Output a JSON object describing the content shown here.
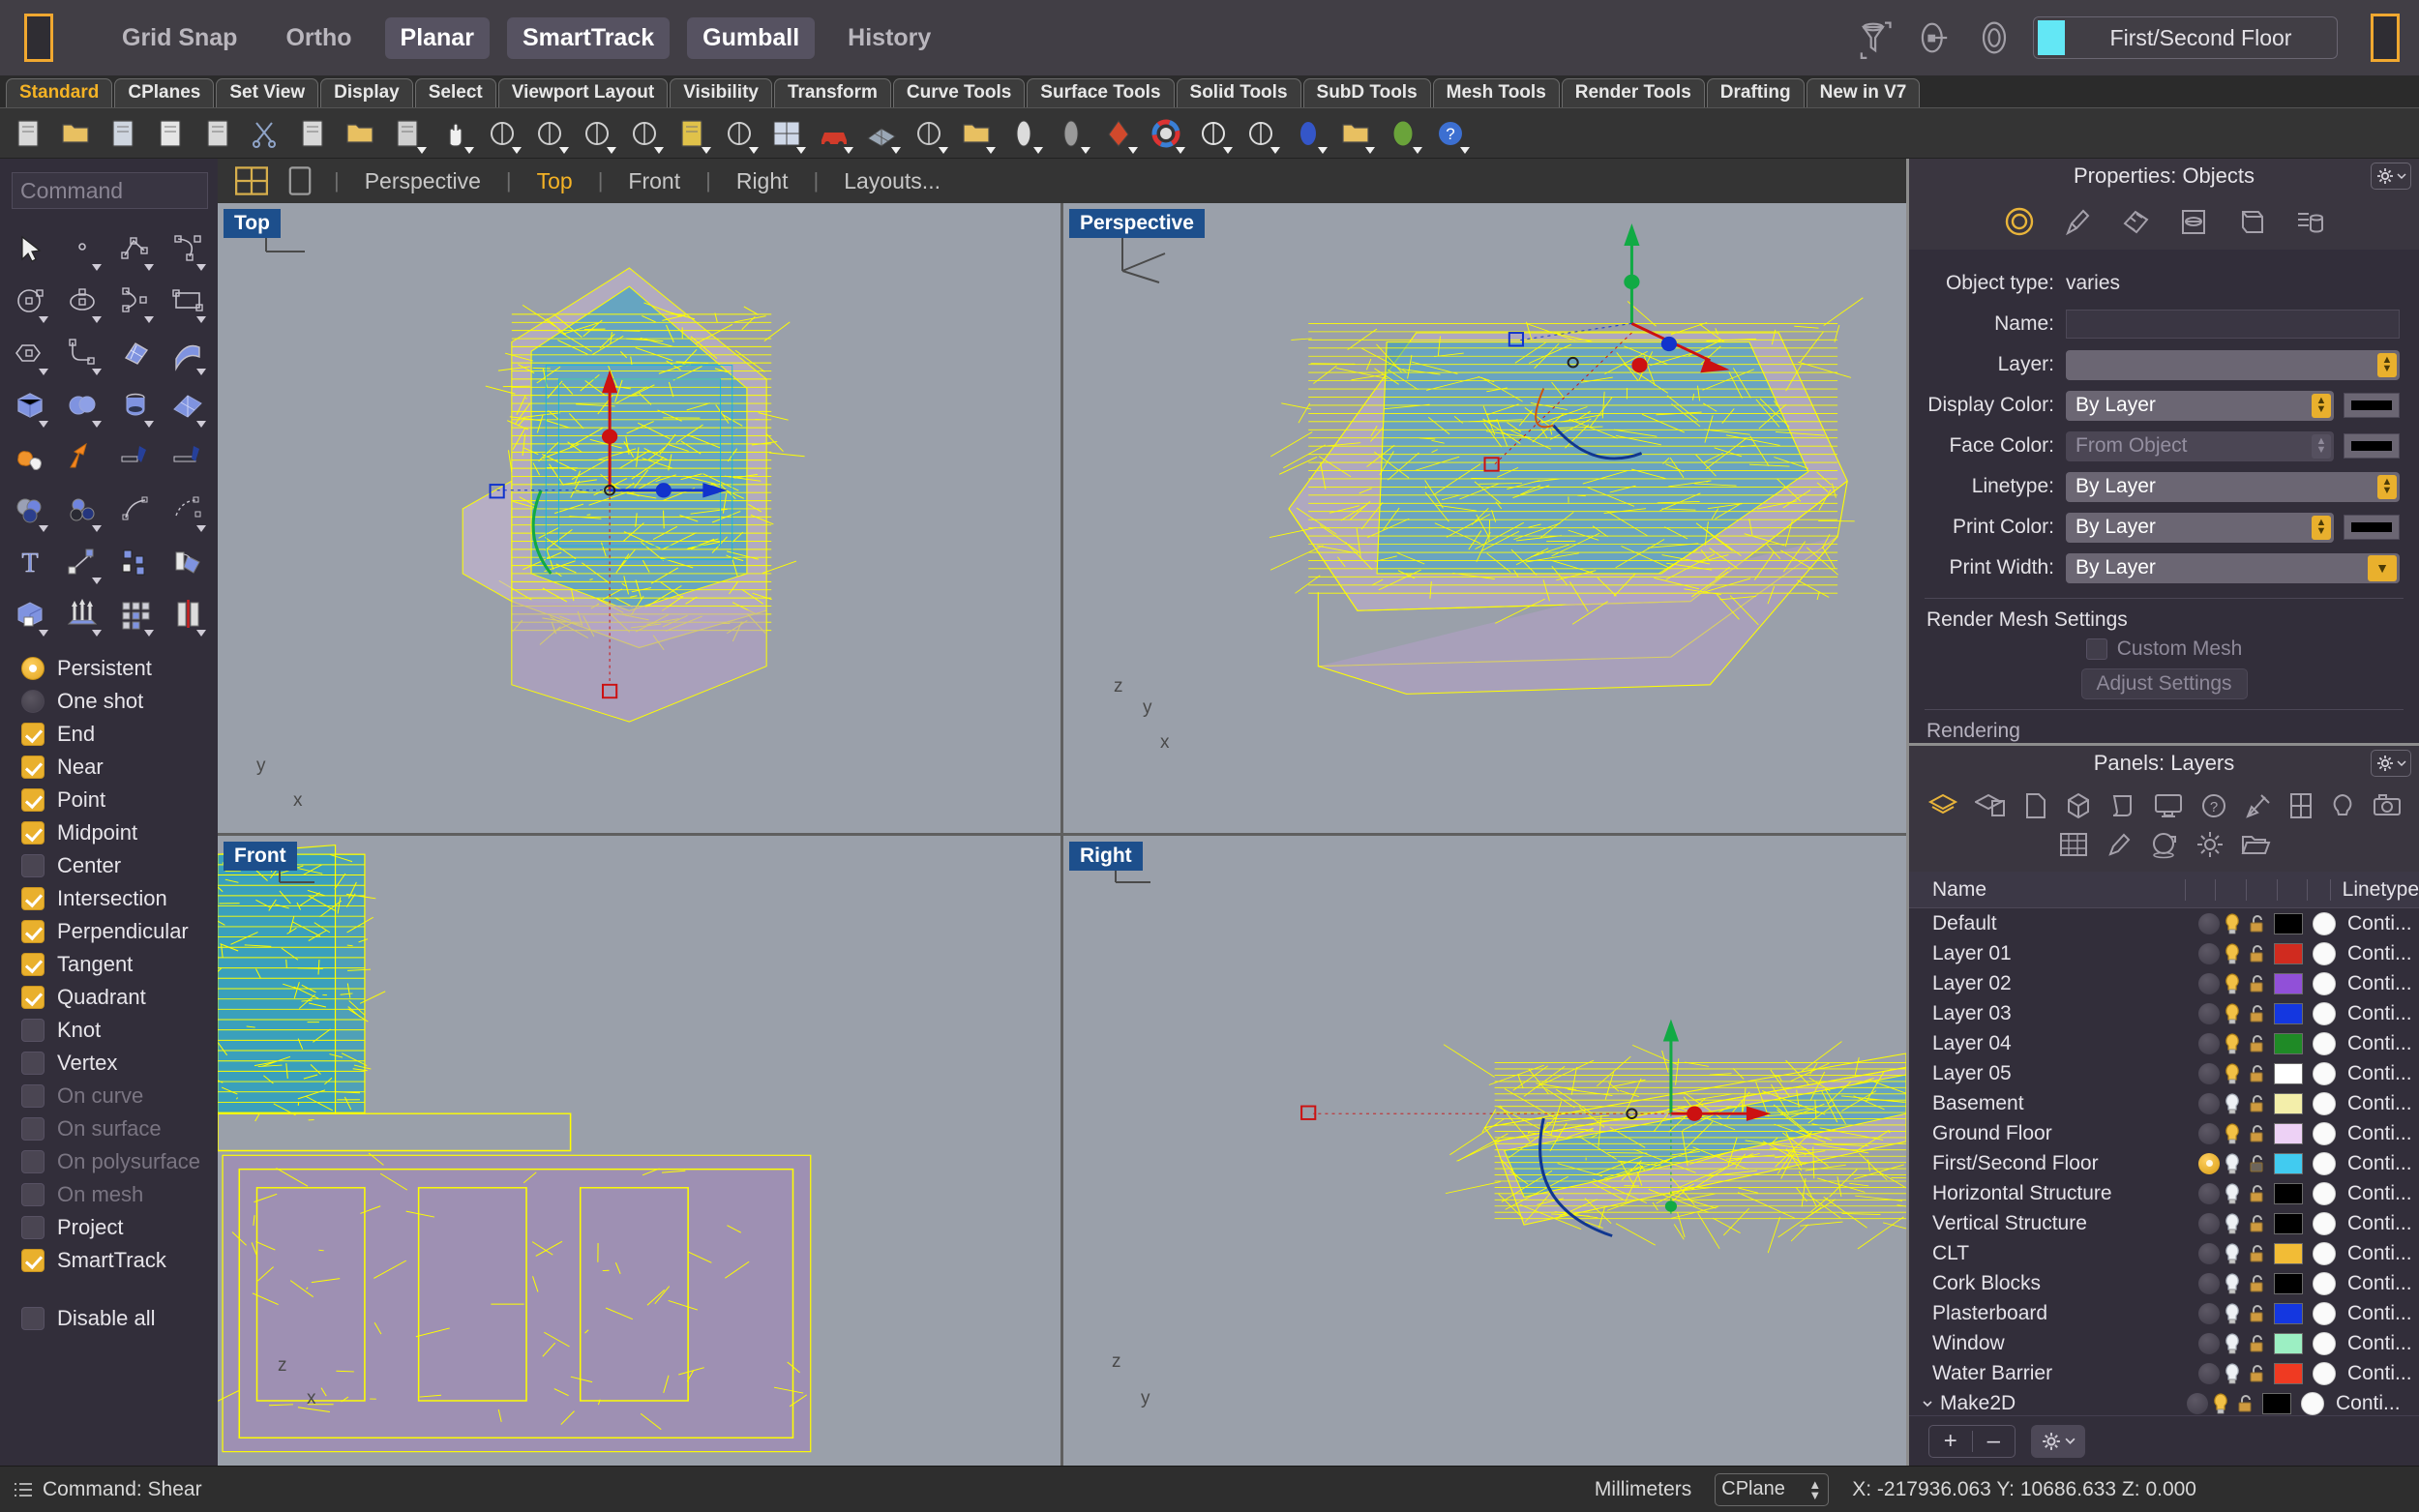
{
  "topbar": {
    "toggles": [
      {
        "label": "Grid Snap",
        "on": false
      },
      {
        "label": "Ortho",
        "on": false
      },
      {
        "label": "Planar",
        "on": true
      },
      {
        "label": "SmartTrack",
        "on": true
      },
      {
        "label": "Gumball",
        "on": true
      },
      {
        "label": "History",
        "on": false
      }
    ],
    "layer_selector": {
      "name": "First/Second Floor",
      "color": "#63e7f5"
    },
    "icons": [
      "filter-icon",
      "named-view-icon",
      "target-icon"
    ]
  },
  "tabs": [
    {
      "label": "Standard",
      "active": true
    },
    {
      "label": "CPlanes",
      "active": false
    },
    {
      "label": "Set View",
      "active": false
    },
    {
      "label": "Display",
      "active": false
    },
    {
      "label": "Select",
      "active": false
    },
    {
      "label": "Viewport Layout",
      "active": false
    },
    {
      "label": "Visibility",
      "active": false
    },
    {
      "label": "Transform",
      "active": false
    },
    {
      "label": "Curve Tools",
      "active": false
    },
    {
      "label": "Surface Tools",
      "active": false
    },
    {
      "label": "Solid Tools",
      "active": false
    },
    {
      "label": "SubD Tools",
      "active": false
    },
    {
      "label": "Mesh Tools",
      "active": false
    },
    {
      "label": "Render Tools",
      "active": false
    },
    {
      "label": "Drafting",
      "active": false
    },
    {
      "label": "New in V7",
      "active": false
    }
  ],
  "toolbar_icons": [
    "new-file-icon",
    "open-folder-icon",
    "save-icon",
    "print-icon",
    "copy-to-clipboard-icon",
    "cut-scissors-icon",
    "copy-icon",
    "paste-icon",
    "undo-icon",
    "pan-hand-icon",
    "zoom-extents-icon",
    "zoom-window-icon",
    "zoom-selected-icon",
    "rotate-view-icon",
    "shade-view-icon",
    "refresh-shade-icon",
    "viewport-layout-icon",
    "car-render-icon",
    "render-mesh-icon",
    "named-cplane-icon",
    "light-icon",
    "spotlight-icon",
    "batch-render-icon",
    "material-icon",
    "color-wheel-icon",
    "environment-icon",
    "ground-plane-icon",
    "sun-icon",
    "layers-stack-icon",
    "render-preview-icon",
    "help-icon"
  ],
  "command": {
    "placeholder": "Command",
    "value": ""
  },
  "tool_palette": [
    "select-arrow-icon",
    "point-icon",
    "polyline-icon",
    "curve-icon",
    "circle-icon",
    "ellipse-icon",
    "arc-icon",
    "rectangle-icon",
    "polygon-icon",
    "fillet-curve-icon",
    "surface-from-curves-icon",
    "extrude-surface-icon",
    "box-icon",
    "sphere-icon",
    "cylinder-icon",
    "surface-grid-icon",
    "boolean-union-icon",
    "explode-icon",
    "trim-icon",
    "split-icon",
    "boolean-difference-icon",
    "boolean-intersection-icon",
    "offset-curve-icon",
    "offset-surface-icon",
    "text-icon",
    "move-icon",
    "copy-objects-icon",
    "rotate-object-icon",
    "extrude-solid-icon",
    "array-linear-icon",
    "array-grid-icon",
    "mirror-icon"
  ],
  "snaps": {
    "mode": [
      {
        "label": "Persistent",
        "selected": true
      },
      {
        "label": "One shot",
        "selected": false
      }
    ],
    "items": [
      {
        "label": "End",
        "checked": true,
        "disabled": false
      },
      {
        "label": "Near",
        "checked": true,
        "disabled": false
      },
      {
        "label": "Point",
        "checked": true,
        "disabled": false
      },
      {
        "label": "Midpoint",
        "checked": true,
        "disabled": false
      },
      {
        "label": "Center",
        "checked": false,
        "disabled": false
      },
      {
        "label": "Intersection",
        "checked": true,
        "disabled": false
      },
      {
        "label": "Perpendicular",
        "checked": true,
        "disabled": false
      },
      {
        "label": "Tangent",
        "checked": true,
        "disabled": false
      },
      {
        "label": "Quadrant",
        "checked": true,
        "disabled": false
      },
      {
        "label": "Knot",
        "checked": false,
        "disabled": false
      },
      {
        "label": "Vertex",
        "checked": false,
        "disabled": false
      },
      {
        "label": "On curve",
        "checked": false,
        "disabled": true
      },
      {
        "label": "On surface",
        "checked": false,
        "disabled": true
      },
      {
        "label": "On polysurface",
        "checked": false,
        "disabled": true
      },
      {
        "label": "On mesh",
        "checked": false,
        "disabled": true
      },
      {
        "label": "Project",
        "checked": false,
        "disabled": false
      },
      {
        "label": "SmartTrack",
        "checked": true,
        "disabled": false
      }
    ],
    "disable_all": {
      "label": "Disable all",
      "checked": false
    }
  },
  "viewtabs": {
    "icons": [
      "four-view-layout-icon",
      "single-view-layout-icon"
    ],
    "items": [
      {
        "label": "Perspective",
        "active": false
      },
      {
        "label": "Top",
        "active": true
      },
      {
        "label": "Front",
        "active": false
      },
      {
        "label": "Right",
        "active": false
      },
      {
        "label": "Layouts...",
        "active": false
      }
    ]
  },
  "viewports": [
    {
      "label": "Top",
      "axes": [
        "y",
        "x"
      ]
    },
    {
      "label": "Perspective",
      "axes": [
        "z",
        "y",
        "x"
      ]
    },
    {
      "label": "Front",
      "axes": [
        "z",
        "x"
      ]
    },
    {
      "label": "Right",
      "axes": [
        "z",
        "y"
      ]
    }
  ],
  "properties": {
    "header": "Properties: Objects",
    "tab_icons": [
      "object-properties-icon",
      "material-icon",
      "texture-mapping-icon",
      "display-mode-icon",
      "object-display-icon",
      "layer-list-icon"
    ],
    "object_type_label": "Object type:",
    "object_type_value": "varies",
    "fields": [
      {
        "label": "Name:",
        "value": "",
        "type": "text"
      },
      {
        "label": "Layer:",
        "value": "",
        "type": "combo-empty"
      },
      {
        "label": "Display Color:",
        "value": "By Layer",
        "type": "combo-swatch",
        "swatch": "#000000"
      },
      {
        "label": "Face Color:",
        "value": "From Object",
        "type": "combo-swatch-dim",
        "swatch": "#000000"
      },
      {
        "label": "Linetype:",
        "value": "By Layer",
        "type": "combo"
      },
      {
        "label": "Print Color:",
        "value": "By Layer",
        "type": "combo-swatch",
        "swatch": "#000000"
      },
      {
        "label": "Print Width:",
        "value": "By Layer",
        "type": "combo-wide"
      }
    ],
    "render_mesh_section": "Render Mesh Settings",
    "custom_mesh": {
      "label": "Custom Mesh",
      "checked": false
    },
    "adjust_settings": "Adjust Settings",
    "rendering_section": "Rendering"
  },
  "layers_panel": {
    "header": "Panels: Layers",
    "row1_icons": [
      "layers-icon",
      "layers-copy-icon",
      "page-icon",
      "box-icon",
      "scroll-icon",
      "display-icon",
      "help-circle-icon",
      "tools-icon",
      "window-icon",
      "light-bulb-icon",
      "camera-icon"
    ],
    "row2_icons": [
      "grid-icon",
      "material-paint-icon",
      "environment-icon",
      "sun-icon",
      "folder-icon"
    ],
    "columns": [
      "Name",
      "Linetype"
    ],
    "rows": [
      {
        "name": "Default",
        "current": false,
        "on": true,
        "locked": false,
        "color": "#000000",
        "linetype": "Conti..."
      },
      {
        "name": "Layer 01",
        "current": false,
        "on": true,
        "locked": false,
        "color": "#d02b1f",
        "linetype": "Conti..."
      },
      {
        "name": "Layer 02",
        "current": false,
        "on": true,
        "locked": false,
        "color": "#9150d8",
        "linetype": "Conti..."
      },
      {
        "name": "Layer 03",
        "current": false,
        "on": true,
        "locked": false,
        "color": "#1437e0",
        "linetype": "Conti..."
      },
      {
        "name": "Layer 04",
        "current": false,
        "on": true,
        "locked": false,
        "color": "#1f8a26",
        "linetype": "Conti..."
      },
      {
        "name": "Layer 05",
        "current": false,
        "on": true,
        "locked": false,
        "color": "#ffffff",
        "linetype": "Conti..."
      },
      {
        "name": "Basement",
        "current": false,
        "on": false,
        "locked": false,
        "color": "#f3eeaa",
        "linetype": "Conti..."
      },
      {
        "name": "Ground Floor",
        "current": false,
        "on": true,
        "locked": false,
        "color": "#edd1f5",
        "linetype": "Conti..."
      },
      {
        "name": "First/Second Floor",
        "current": true,
        "on": false,
        "locked": true,
        "color": "#41cbf0",
        "linetype": "Conti..."
      },
      {
        "name": "Horizontal Structure",
        "current": false,
        "on": false,
        "locked": false,
        "color": "#000000",
        "linetype": "Conti..."
      },
      {
        "name": "Vertical Structure",
        "current": false,
        "on": false,
        "locked": false,
        "color": "#000000",
        "linetype": "Conti..."
      },
      {
        "name": "CLT",
        "current": false,
        "on": false,
        "locked": false,
        "color": "#f2bc36",
        "linetype": "Conti..."
      },
      {
        "name": "Cork Blocks",
        "current": false,
        "on": false,
        "locked": false,
        "color": "#000000",
        "linetype": "Conti..."
      },
      {
        "name": "Plasterboard",
        "current": false,
        "on": false,
        "locked": false,
        "color": "#1437e0",
        "linetype": "Conti..."
      },
      {
        "name": "Window",
        "current": false,
        "on": false,
        "locked": false,
        "color": "#9cefc3",
        "linetype": "Conti..."
      },
      {
        "name": "Water Barrier",
        "current": false,
        "on": false,
        "locked": false,
        "color": "#ef3a22",
        "linetype": "Conti..."
      },
      {
        "name": "Make2D",
        "current": false,
        "on": true,
        "locked": false,
        "color": "#000000",
        "linetype": "Conti...",
        "expandable": true
      }
    ],
    "footer": {
      "add": "+",
      "remove": "–",
      "gear": "gear-icon"
    }
  },
  "statusbar": {
    "command_status": "Command: Shear",
    "units": "Millimeters",
    "cplane": "CPlane",
    "coordinates": "X: -217936.063 Y: 10686.633    Z: 0.000"
  }
}
